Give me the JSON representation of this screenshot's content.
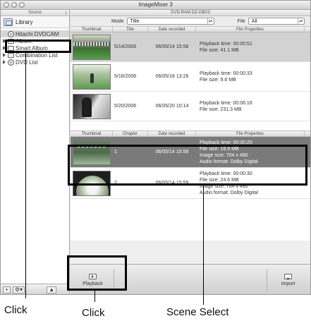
{
  "window": {
    "title": "ImageMixer 3"
  },
  "sidebar": {
    "header": "Source",
    "library": "Library",
    "tree": [
      {
        "label": "Hitachi DVDCAM",
        "selected": true
      },
      {
        "label": "Album",
        "selected": false
      },
      {
        "label": "Smart Album",
        "selected": false
      },
      {
        "label": "Combination List",
        "selected": false
      },
      {
        "label": "DVD List",
        "selected": false
      }
    ],
    "footer": {
      "add": "+",
      "gear": "⚙",
      "gear_arrow": "▾",
      "eject": "▲"
    }
  },
  "main": {
    "device": "DVD-RAM DZ-GBX3",
    "toolbar": {
      "mode_label": "Mode",
      "mode_value": "Title",
      "file_label": "File",
      "file_value": "All"
    },
    "titles_table": {
      "headers": [
        "Thumbnail",
        "Title",
        "Date recorded",
        "File Properties"
      ],
      "rows": [
        {
          "title": "5/14/2006",
          "date": "06/05/14 15:58",
          "prop1": "Playback time: 00:00:51",
          "prop2": "File size: 41.1 MB"
        },
        {
          "title": "5/18/2006",
          "date": "06/05/18 13:26",
          "prop1": "Playback time: 00:00:33",
          "prop2": "File size: 9.6 MB"
        },
        {
          "title": "5/20/2006",
          "date": "06/05/20 10:14",
          "prop1": "Playback time: 00:06:16",
          "prop2": "File size: 231.3 MB"
        }
      ]
    },
    "chapters_table": {
      "headers": [
        "Thumbnail",
        "Chapter",
        "Date recorded",
        "File Properties"
      ],
      "rows": [
        {
          "chapter": "1",
          "date": "06/05/14 15:58",
          "prop1": "Playback time: 00:00:20",
          "prop2": "File size: 16.5 MB",
          "prop3": "Image size: 704 x 480",
          "prop4": "Audio format: Dolby Digital"
        },
        {
          "chapter": "2",
          "date": "06/05/14 15:59",
          "prop1": "Playback time: 00:00:30",
          "prop2": "File size: 24.6 MB",
          "prop3": "Image size: 704 x 480",
          "prop4": "Audio format: Dolby Digital"
        }
      ]
    },
    "buttons": {
      "playback": "Playback",
      "import": "Import"
    }
  },
  "annotations": {
    "click_1": "Click",
    "click_2": "Click",
    "scene_select": "Scene Select"
  },
  "colors": {
    "highlight_border": "#000000",
    "selected_row": "#7a7a7a"
  }
}
